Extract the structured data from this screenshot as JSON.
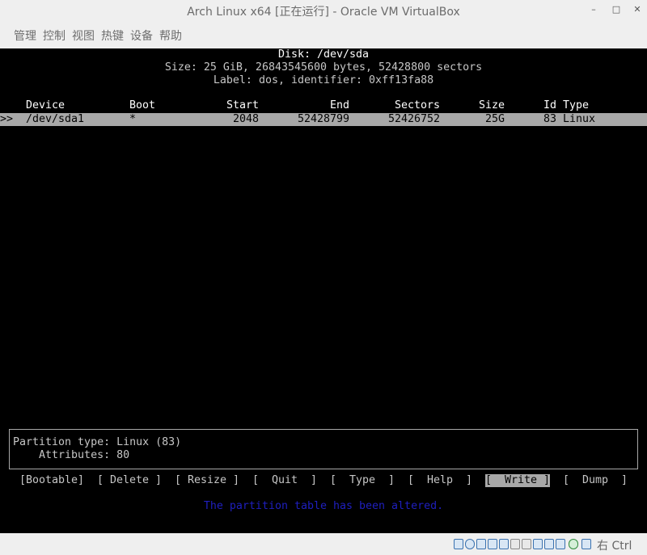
{
  "window": {
    "title": "Arch Linux x64 [正在运行] - Oracle VM VirtualBox",
    "minimize_glyph": "–",
    "maximize_glyph": "□",
    "close_glyph": "✕"
  },
  "menu": [
    "管理",
    "控制",
    "视图",
    "热键",
    "设备",
    "帮助"
  ],
  "disk": {
    "title": "Disk: /dev/sda",
    "size_line": "Size: 25 GiB, 26843545600 bytes, 52428800 sectors",
    "label_line": "Label: dos, identifier: 0xff13fa88"
  },
  "table": {
    "headers": {
      "device": "Device",
      "boot": "Boot",
      "start": "Start",
      "end": "End",
      "sectors": "Sectors",
      "size": "Size",
      "id": "Id",
      "type": "Type"
    },
    "rows": [
      {
        "marker": ">>",
        "device": "/dev/sda1",
        "boot": "*",
        "start": "2048",
        "end": "52428799",
        "sectors": "52426752",
        "size": "25G",
        "id": "83",
        "type": "Linux"
      }
    ]
  },
  "info": {
    "partition_type": "Partition type: Linux (83)",
    "attributes": "    Attributes: 80"
  },
  "actions": [
    {
      "label": "[Bootable]",
      "selected": false
    },
    {
      "label": "[ Delete ]",
      "selected": false
    },
    {
      "label": "[ Resize ]",
      "selected": false
    },
    {
      "label": "[  Quit  ]",
      "selected": false
    },
    {
      "label": "[  Type  ]",
      "selected": false
    },
    {
      "label": "[  Help  ]",
      "selected": false
    },
    {
      "label": "[  Write ]",
      "selected": true
    },
    {
      "label": "[  Dump  ]",
      "selected": false
    }
  ],
  "status_message": "The partition table has been altered.",
  "statusbar": {
    "host_key": "右 Ctrl",
    "icons": [
      "hard-disk-icon",
      "optical-drive-icon",
      "audio-icon",
      "network-icon",
      "usb-icon",
      "shared-folder-icon",
      "display-icon",
      "video-capture-icon",
      "recording-icon",
      "cpu-icon",
      "mouse-integration-icon",
      "keyboard-icon"
    ]
  }
}
